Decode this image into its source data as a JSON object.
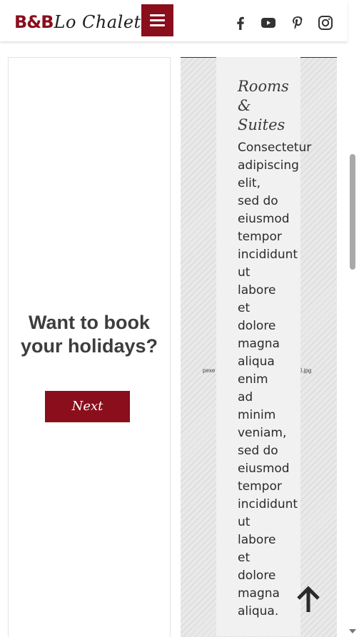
{
  "header": {
    "logo_main": "B&B",
    "logo_script": "Lo Chalet",
    "menu_icon": "hamburger-icon",
    "social": [
      {
        "name": "facebook",
        "icon": "facebook-icon"
      },
      {
        "name": "youtube",
        "icon": "youtube-icon"
      },
      {
        "name": "pinterest",
        "icon": "pinterest-icon"
      },
      {
        "name": "instagram",
        "icon": "instagram-icon"
      }
    ]
  },
  "booking": {
    "title": "Want to book your holidays?",
    "next_label": "Next"
  },
  "rooms": {
    "image_caption_left": "pexe",
    "image_caption_right": "0.jpg",
    "title_lines": [
      "Rooms",
      "&",
      "Suites"
    ],
    "body_lines": [
      "Consectetur",
      "adipiscing",
      "elit,",
      "sed do",
      "eiusmod",
      "tempor",
      "incididunt",
      "ut",
      "labore",
      "et",
      "dolore",
      "magna",
      "aliqua",
      "enim",
      "ad",
      "minim",
      "veniam,",
      "sed do",
      "eiusmod",
      "tempor",
      "incididunt",
      "ut",
      "labore",
      "et",
      "dolore",
      "magna",
      "aliqua."
    ]
  },
  "colors": {
    "brand": "#8a0e1c",
    "panel_bg": "#f1f1f1",
    "text_dark": "#3d3d3d"
  },
  "icons": {
    "back_to_top": "arrow-up-icon"
  }
}
